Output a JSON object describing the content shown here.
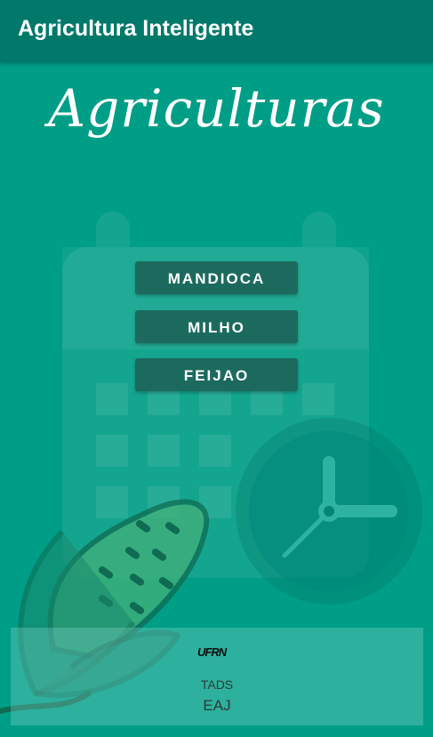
{
  "app": {
    "title": "Agricultura Inteligente"
  },
  "main": {
    "headline": "Agriculturas",
    "buttons": [
      {
        "label": "MANDIOCA"
      },
      {
        "label": "MILHO"
      },
      {
        "label": "FEIJAO"
      }
    ]
  },
  "footer": {
    "logo_text": "UFRN",
    "line1": "TADS",
    "line2": "EAJ"
  },
  "icons": [
    "calendar-icon",
    "clock-icon",
    "corn-icon"
  ],
  "colors": {
    "appbar": "#00796b",
    "background": "#009e86",
    "button": "#1c6a5e"
  }
}
